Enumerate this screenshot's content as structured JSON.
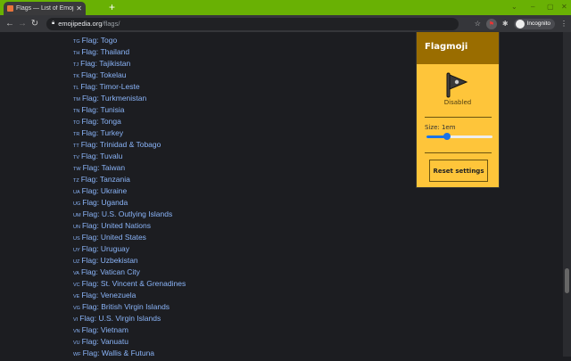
{
  "browser": {
    "tab_title": "Flags — List of Emoji Flags to",
    "url_host": "emojipedia.org",
    "url_path": "/flags/",
    "incognito_label": "Incognito"
  },
  "flags": [
    {
      "code": "TG",
      "label": "Flag: Togo"
    },
    {
      "code": "TH",
      "label": "Flag: Thailand"
    },
    {
      "code": "TJ",
      "label": "Flag: Tajikistan"
    },
    {
      "code": "TK",
      "label": "Flag: Tokelau"
    },
    {
      "code": "TL",
      "label": "Flag: Timor-Leste"
    },
    {
      "code": "TM",
      "label": "Flag: Turkmenistan"
    },
    {
      "code": "TN",
      "label": "Flag: Tunisia"
    },
    {
      "code": "TO",
      "label": "Flag: Tonga"
    },
    {
      "code": "TR",
      "label": "Flag: Turkey"
    },
    {
      "code": "TT",
      "label": "Flag: Trinidad & Tobago"
    },
    {
      "code": "TV",
      "label": "Flag: Tuvalu"
    },
    {
      "code": "TW",
      "label": "Flag: Taiwan"
    },
    {
      "code": "TZ",
      "label": "Flag: Tanzania"
    },
    {
      "code": "UA",
      "label": "Flag: Ukraine"
    },
    {
      "code": "UG",
      "label": "Flag: Uganda"
    },
    {
      "code": "UM",
      "label": "Flag: U.S. Outlying Islands"
    },
    {
      "code": "UN",
      "label": "Flag: United Nations"
    },
    {
      "code": "US",
      "label": "Flag: United States"
    },
    {
      "code": "UY",
      "label": "Flag: Uruguay"
    },
    {
      "code": "UZ",
      "label": "Flag: Uzbekistan"
    },
    {
      "code": "VA",
      "label": "Flag: Vatican City"
    },
    {
      "code": "VC",
      "label": "Flag: St. Vincent & Grenadines"
    },
    {
      "code": "VE",
      "label": "Flag: Venezuela"
    },
    {
      "code": "VG",
      "label": "Flag: British Virgin Islands"
    },
    {
      "code": "VI",
      "label": "Flag: U.S. Virgin Islands"
    },
    {
      "code": "VN",
      "label": "Flag: Vietnam"
    },
    {
      "code": "VU",
      "label": "Flag: Vanuatu"
    },
    {
      "code": "WF",
      "label": "Flag: Wallis & Futuna"
    }
  ],
  "popup": {
    "title": "Flagmoji",
    "status": "Disabled",
    "size_label": "Size: 1em",
    "size_value_fraction": 0.3,
    "reset_label": "Reset settings"
  }
}
